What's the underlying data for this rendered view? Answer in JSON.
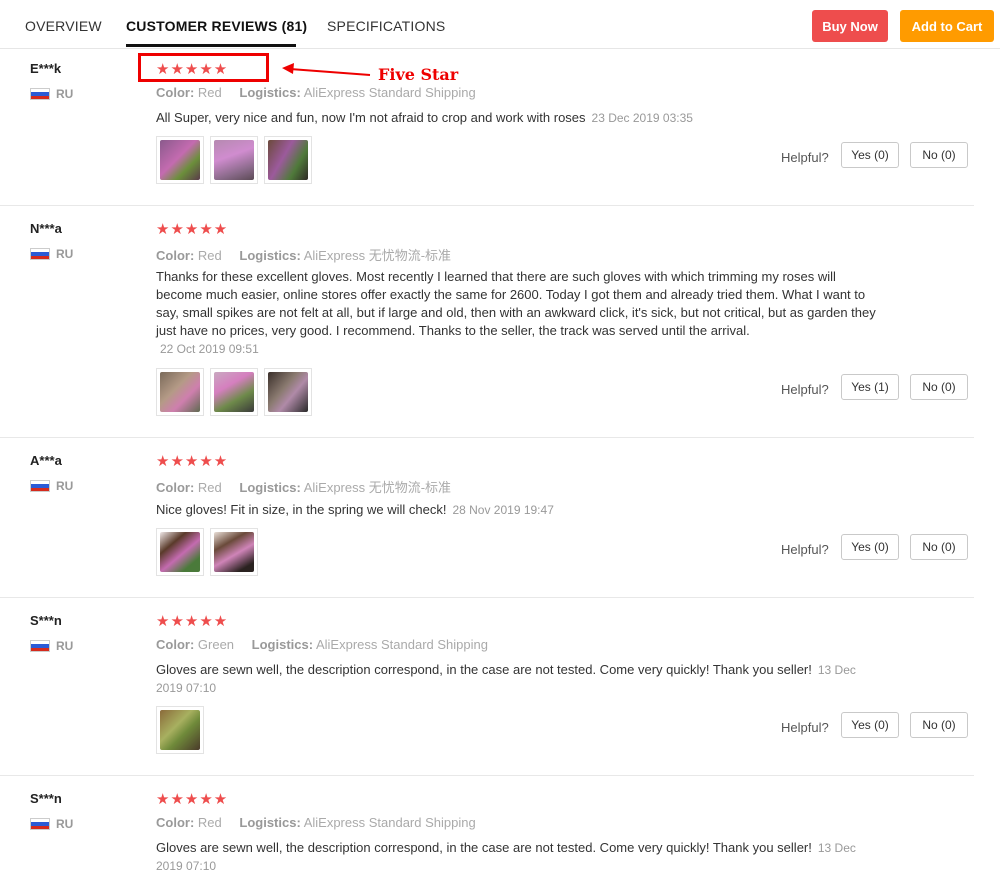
{
  "tabs": [
    {
      "label": "OVERVIEW"
    },
    {
      "label": "CUSTOMER REVIEWS (81)"
    },
    {
      "label": "SPECIFICATIONS"
    }
  ],
  "actions": {
    "buy_now": "Buy Now",
    "add_to_cart": "Add to Cart"
  },
  "annotation": {
    "text": "Five Star"
  },
  "stars_glyph": "★★★★★",
  "helpful_label": "Helpful?",
  "reviews": [
    {
      "user": "E***k",
      "country": "RU",
      "rating": 5,
      "color_label": "Color:",
      "color": "Red",
      "logistics_label": "Logistics:",
      "logistics": "AliExpress Standard Shipping",
      "text": "All Super, very nice and fun, now I'm not afraid to crop and work with roses",
      "date": "23 Dec 2019 03:35",
      "yes": "Yes (0)",
      "no": "No (0)"
    },
    {
      "user": "N***a",
      "country": "RU",
      "rating": 5,
      "color_label": "Color:",
      "color": "Red",
      "logistics_label": "Logistics:",
      "logistics": "AliExpress 无忧物流-标准",
      "text": "Thanks for these excellent gloves. Most recently I learned that there are such gloves with which trimming my roses will become much easier, online stores offer exactly the same for 2600. Today I got them and already tried them. What I want to say, small spikes are not felt at all, but if large and old, then with an awkward click, it's sick, but not critical, but as garden they just have no prices, very good. I recommend. Thanks to the seller, the track was served until the arrival.",
      "date": "22 Oct 2019 09:51",
      "yes": "Yes (1)",
      "no": "No (0)"
    },
    {
      "user": "A***a",
      "country": "RU",
      "rating": 5,
      "color_label": "Color:",
      "color": "Red",
      "logistics_label": "Logistics:",
      "logistics": "AliExpress 无忧物流-标准",
      "text": "Nice gloves! Fit in size, in the spring we will check!",
      "date": "28 Nov 2019 19:47",
      "yes": "Yes (0)",
      "no": "No (0)"
    },
    {
      "user": "S***n",
      "country": "RU",
      "rating": 5,
      "color_label": "Color:",
      "color": "Green",
      "logistics_label": "Logistics:",
      "logistics": "AliExpress Standard Shipping",
      "text": "Gloves are sewn well, the description correspond, in the case are not tested. Come very quickly! Thank you seller!",
      "date": "13 Dec 2019 07:10",
      "yes": "Yes (0)",
      "no": "No (0)"
    },
    {
      "user": "S***n",
      "country": "RU",
      "rating": 5,
      "color_label": "Color:",
      "color": "Red",
      "logistics_label": "Logistics:",
      "logistics": "AliExpress Standard Shipping",
      "text": "Gloves are sewn well, the description correspond, in the case are not tested. Come very quickly! Thank you seller!",
      "date": "13 Dec 2019 07:10"
    }
  ]
}
